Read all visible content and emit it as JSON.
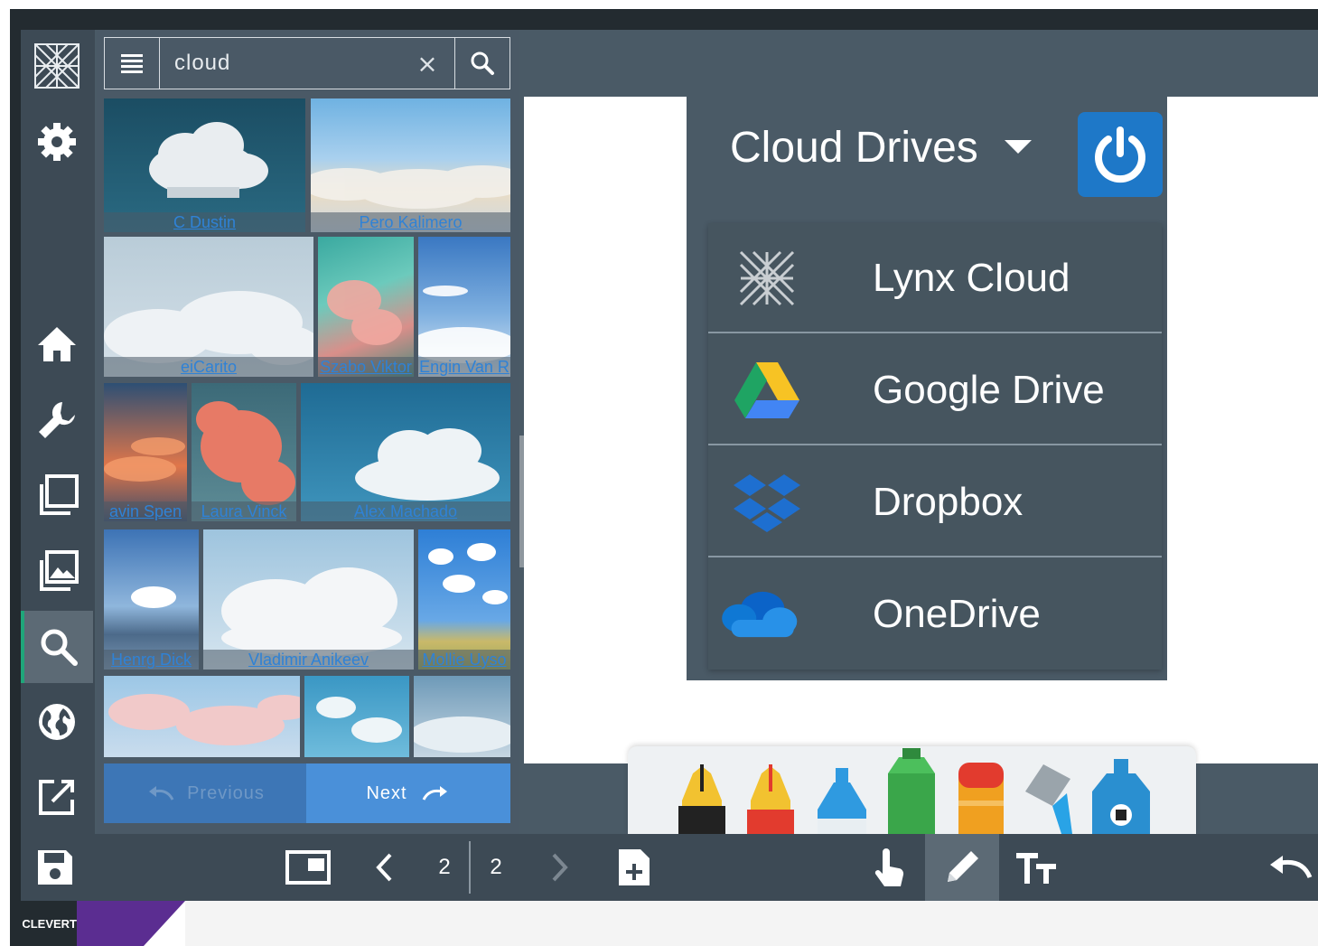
{
  "search": {
    "query": "cloud",
    "clear_glyph": "×"
  },
  "results": {
    "rows": [
      [
        {
          "credit": "C Dustin",
          "icon": "cloud-photo"
        },
        {
          "credit": "Pero Kalimero",
          "icon": "cloud-photo"
        }
      ],
      [
        {
          "credit": "eiCarito",
          "icon": "cloud-photo"
        },
        {
          "credit": "Szabo Viktor",
          "icon": "cloud-photo"
        },
        {
          "credit": "Engin Van R",
          "icon": "cloud-photo"
        }
      ],
      [
        {
          "credit": "avin Spen",
          "icon": "cloud-photo"
        },
        {
          "credit": "Laura Vinck",
          "icon": "cloud-photo"
        },
        {
          "credit": "Alex Machado",
          "icon": "cloud-photo"
        }
      ],
      [
        {
          "credit": "Henrg Dick",
          "icon": "cloud-photo"
        },
        {
          "credit": "Vladimir Anikeev",
          "icon": "cloud-photo"
        },
        {
          "credit": "Mollie Uyso",
          "icon": "cloud-photo"
        }
      ],
      [
        {
          "credit": "",
          "icon": "cloud-photo"
        },
        {
          "credit": "",
          "icon": "cloud-photo"
        },
        {
          "credit": "",
          "icon": "cloud-photo"
        }
      ]
    ]
  },
  "pager": {
    "prev_label": "Previous",
    "next_label": "Next"
  },
  "cloud_drives": {
    "title": "Cloud Drives",
    "items": [
      {
        "label": "Lynx Cloud",
        "icon": "lynx-logo-icon"
      },
      {
        "label": "Google Drive",
        "icon": "google-drive-icon"
      },
      {
        "label": "Dropbox",
        "icon": "dropbox-icon"
      },
      {
        "label": "OneDrive",
        "icon": "onedrive-icon"
      }
    ]
  },
  "bottom_bar": {
    "current_page": "2",
    "total_pages": "2"
  },
  "footer": {
    "brand_text": "CLEVERT"
  },
  "colors": {
    "accent_green": "#1fa67a",
    "drive_blue": "#1e78c8",
    "link_blue": "#2f82d6",
    "footer_purple": "#5b2d91"
  },
  "pens": [
    {
      "name": "yellow-highlighter",
      "color": "#f2c230"
    },
    {
      "name": "red-highlighter",
      "color": "#e23b2e"
    },
    {
      "name": "blue-marker",
      "color": "#2f9ae0"
    },
    {
      "name": "green-marker",
      "color": "#3aa64a"
    },
    {
      "name": "orange-paint",
      "color": "#f0a020"
    },
    {
      "name": "paint-bucket",
      "color": "#29a3e6"
    },
    {
      "name": "eraser",
      "color": "#2a8fd0"
    }
  ]
}
